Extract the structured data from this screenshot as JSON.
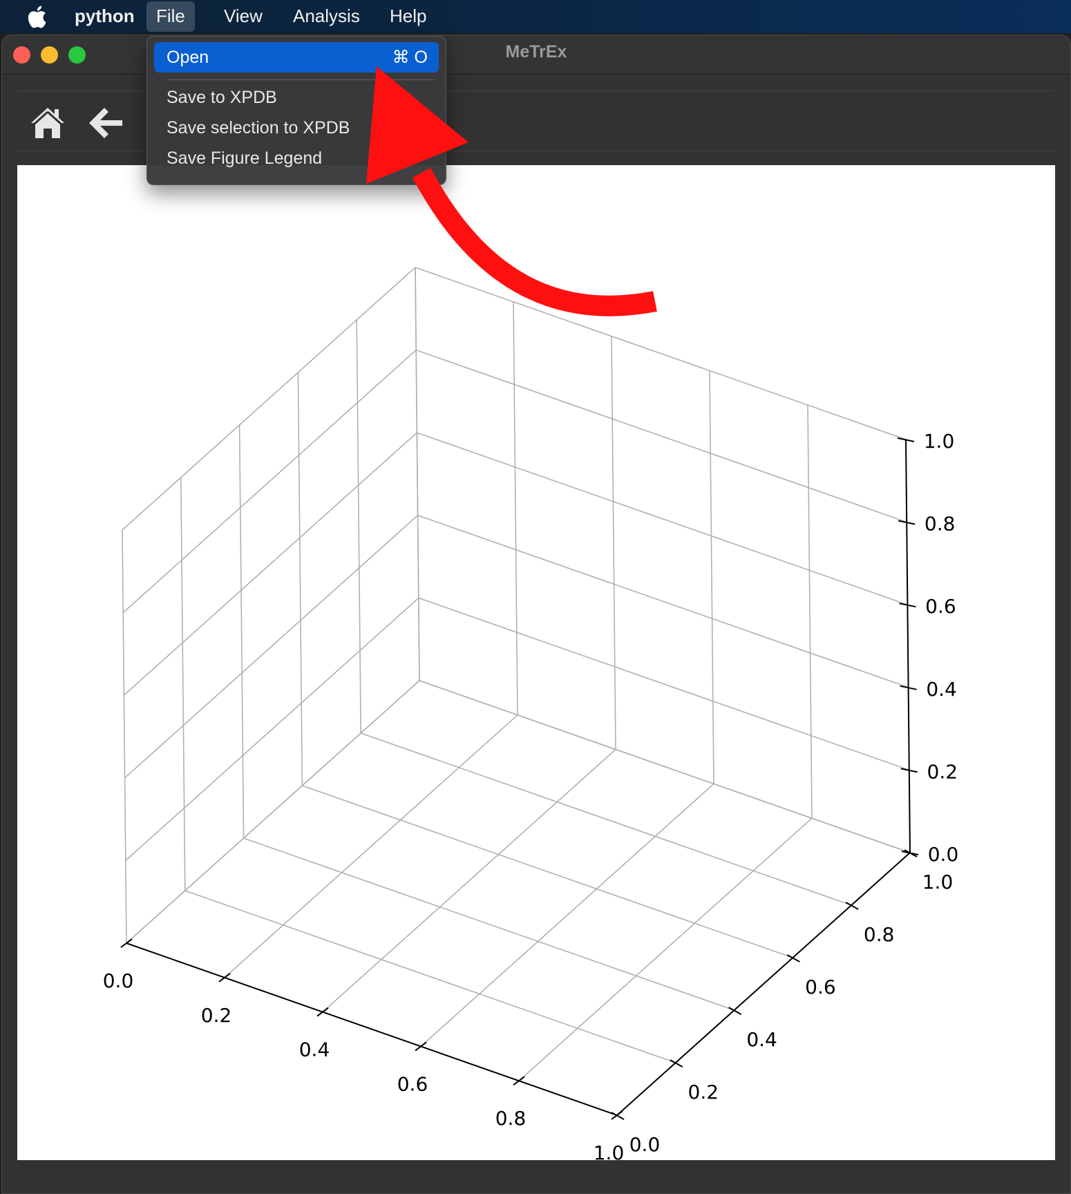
{
  "menubar": {
    "app_name": "python",
    "items": [
      "File",
      "View",
      "Analysis",
      "Help"
    ],
    "active_item": "File"
  },
  "window": {
    "title": "MeTrEx",
    "traffic_light_colors": [
      "#fe5f57",
      "#febc2e",
      "#28c840"
    ]
  },
  "toolbar": {
    "icons": [
      "home-icon",
      "back-arrow-icon"
    ]
  },
  "file_menu": {
    "items": [
      {
        "label": "Open",
        "shortcut": "⌘ O",
        "selected": true
      },
      {
        "label": "Save to XPDB",
        "shortcut": "",
        "selected": false
      },
      {
        "label": "Save selection to XPDB",
        "shortcut": "",
        "selected": false
      },
      {
        "label": "Save Figure Legend",
        "shortcut": "",
        "selected": false
      }
    ]
  },
  "annotation": {
    "type": "arrow",
    "color": "#ff1010",
    "points_to": "Open"
  },
  "chart_data": {
    "type": "scatter",
    "projection": "3d",
    "title": "",
    "xlabel": "",
    "ylabel": "",
    "zlabel": "",
    "xlim": [
      0.0,
      1.0
    ],
    "ylim": [
      0.0,
      1.0
    ],
    "zlim": [
      0.0,
      1.0
    ],
    "x_ticks": [
      "0.0",
      "0.2",
      "0.4",
      "0.6",
      "0.8",
      "1.0"
    ],
    "y_ticks": [
      "0.0",
      "0.2",
      "0.4",
      "0.6",
      "0.8",
      "1.0"
    ],
    "z_ticks": [
      "0.0",
      "0.2",
      "0.4",
      "0.6",
      "0.8",
      "1.0"
    ],
    "series": [],
    "grid": true,
    "grid_color": "#b0b0b0"
  }
}
